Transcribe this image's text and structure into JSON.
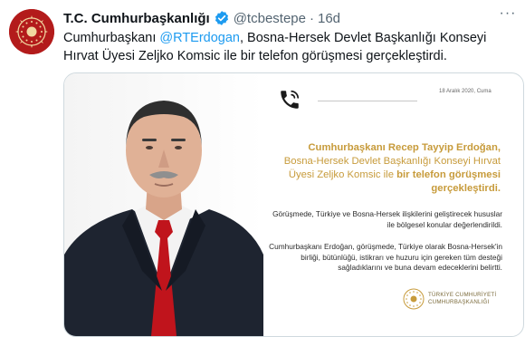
{
  "tweet": {
    "author_name": "T.C. Cumhurbaşkanlığı",
    "handle": "@tcbestepe",
    "separator": "·",
    "time": "16d",
    "text_before": "Cumhurbaşkanı ",
    "mention": "@RTErdogan",
    "text_after": ", Bosna-Hersek Devlet Başkanlığı Konseyi Hırvat Üyesi Zeljko Komsic ile bir telefon görüşmesi gerçekleştirdi.",
    "more": "···"
  },
  "card": {
    "date": "18 Aralık 2020, Cuma",
    "heading_bold1": "Cumhurbaşkanı Recep Tayyip Erdoğan,",
    "heading_normal": "Bosna-Hersek Devlet Başkanlığı Konseyi Hırvat Üyesi Zeljko Komsic ile ",
    "heading_bold2": "bir telefon görüşmesi gerçekleştirdi.",
    "paragraph1": "Görüşmede, Türkiye ve Bosna-Hersek ilişkilerini geliştirecek hususlar ile bölgesel konular değerlendirildi.",
    "paragraph2": "Cumhurbaşkanı Erdoğan, görüşmede, Türkiye olarak Bosna-Hersek'in birliği, bütünlüğü, istikrarı ve huzuru için gereken tüm desteği sağladıklarını ve buna devam edeceklerini belirtti.",
    "emblem_line1": "TÜRKİYE CUMHURİYETİ",
    "emblem_line2": "CUMHURBAŞKANLIĞI"
  },
  "colors": {
    "brand_red": "#b31b1b",
    "gold": "#c79b3b",
    "link_blue": "#1d9bf0",
    "verified_blue": "#1d9bf0"
  },
  "icons": [
    "presidential-seal-avatar",
    "verified-badge-icon",
    "more-options-icon",
    "phone-icon",
    "presidential-emblem-icon"
  ]
}
